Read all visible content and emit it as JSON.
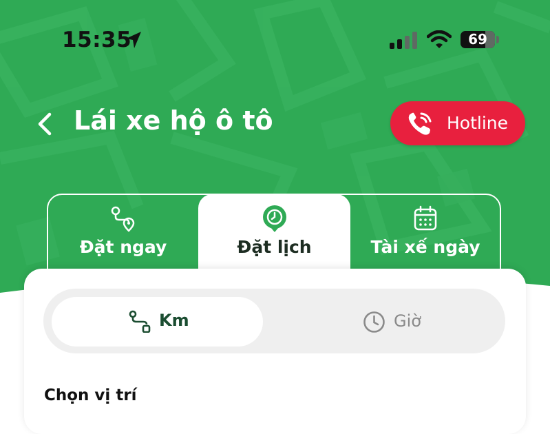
{
  "status_bar": {
    "time": "15:35",
    "battery": "69",
    "location_icon": "location-arrow-icon",
    "signal_icon": "cellular-signal-icon",
    "wifi_icon": "wifi-icon"
  },
  "header": {
    "title": "Lái xe hộ ô tô",
    "back_icon": "chevron-left-icon",
    "hotline_label": "Hotline",
    "hotline_icon": "phone-ringing-icon"
  },
  "tabs": [
    {
      "label": "Đặt ngay",
      "icon": "route-pin-icon",
      "selected": false
    },
    {
      "label": "Đặt lịch",
      "icon": "location-clock-icon",
      "selected": true
    },
    {
      "label": "Tài xế ngày",
      "icon": "calendar-icon",
      "selected": false
    }
  ],
  "segmented": {
    "options": [
      {
        "label": "Km",
        "icon": "route-icon",
        "selected": true
      },
      {
        "label": "Giờ",
        "icon": "clock-icon",
        "selected": false
      }
    ]
  },
  "section": {
    "choose_location": "Chọn vị trí"
  },
  "colors": {
    "brand_green": "#2faa55",
    "dark_green": "#1b4d31",
    "hotline_red": "#e8203e",
    "segment_bg": "#efefef"
  }
}
